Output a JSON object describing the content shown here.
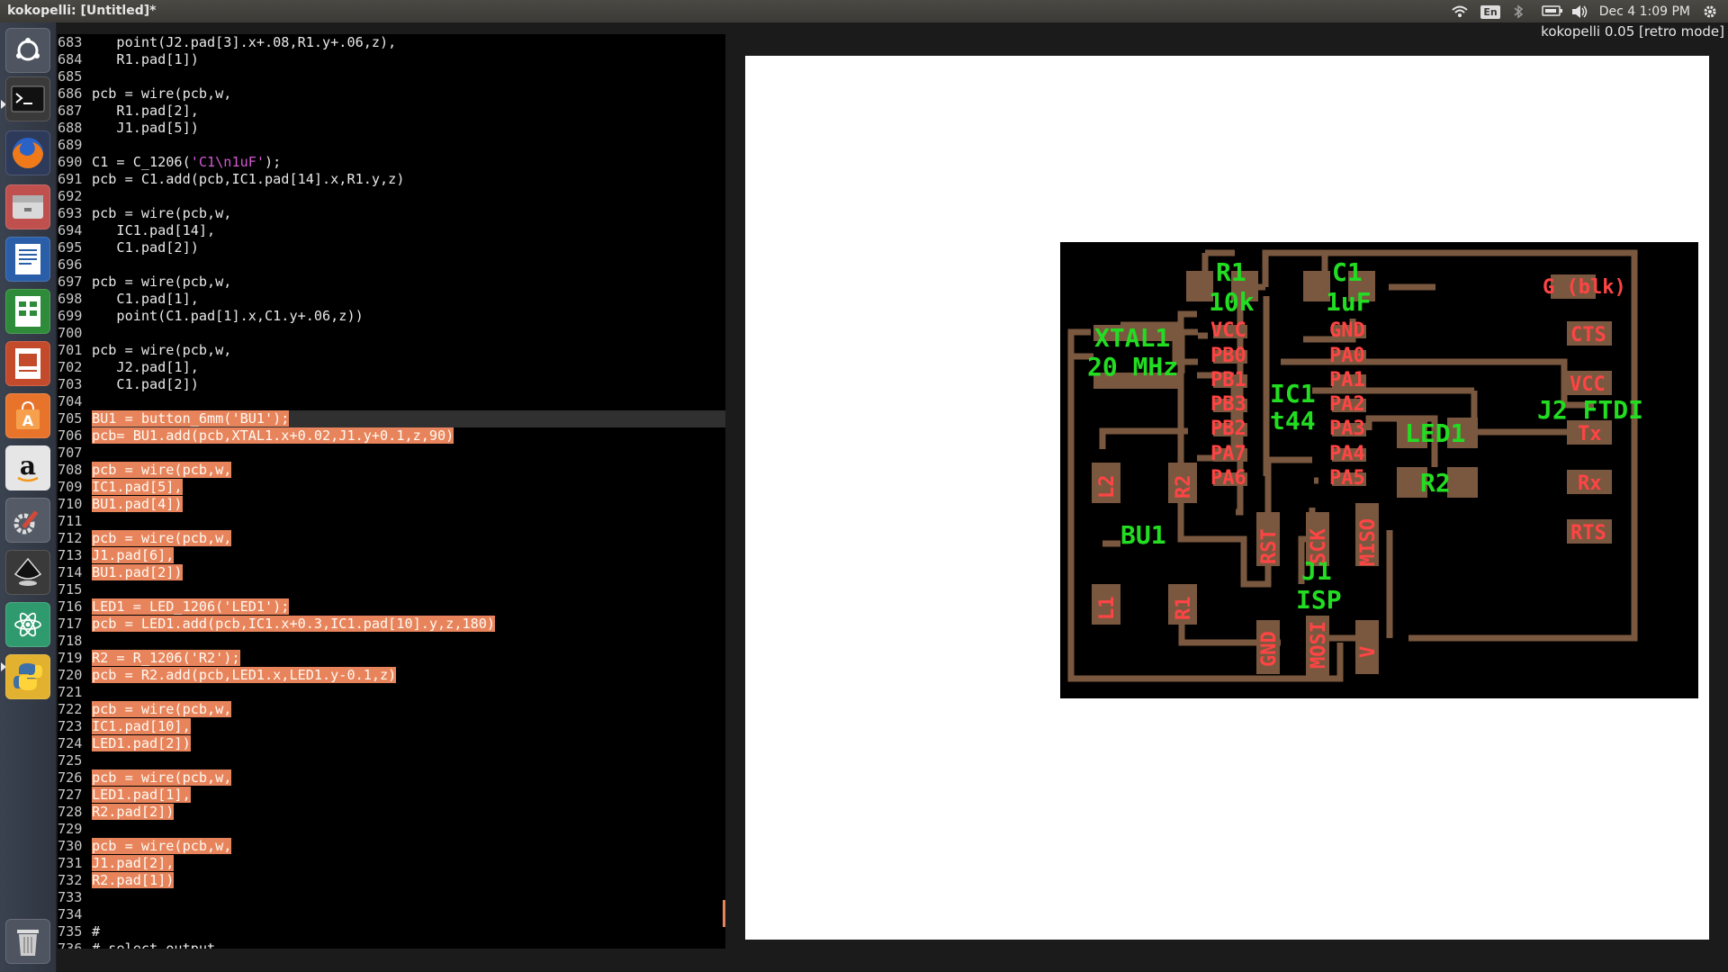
{
  "topbar": {
    "app_name": "kokopelli:",
    "doc_title": "[Untitled]*",
    "keyboard": "En",
    "datetime": "Dec 4  1:09 PM"
  },
  "version_label": "kokopelli 0.05 [retro mode]",
  "launcher": [
    "ubuntu-dash",
    "terminal",
    "firefox",
    "file-manager",
    "writer",
    "calc",
    "impress",
    "software-center",
    "amazon",
    "system-settings",
    "inkscape",
    "atom",
    "python",
    "trash"
  ],
  "editor": {
    "lines": [
      {
        "no": "683",
        "text": "   point(J2.pad[3].x+.08,R1.y+.06,z),",
        "sel": false
      },
      {
        "no": "684",
        "text": "   R1.pad[1])",
        "sel": false
      },
      {
        "no": "685",
        "text": "",
        "sel": false
      },
      {
        "no": "686",
        "text": "pcb = wire(pcb,w,",
        "sel": false
      },
      {
        "no": "687",
        "text": "   R1.pad[2],",
        "sel": false
      },
      {
        "no": "688",
        "text": "   J1.pad[5])",
        "sel": false
      },
      {
        "no": "689",
        "text": "",
        "sel": false
      },
      {
        "no": "690",
        "text": "C1 = C_1206(",
        "str": "'C1\\n1uF'",
        "after": ");",
        "sel": false
      },
      {
        "no": "691",
        "text": "pcb = C1.add(pcb,IC1.pad[14].x,R1.y,z)",
        "sel": false
      },
      {
        "no": "692",
        "text": "",
        "sel": false
      },
      {
        "no": "693",
        "text": "pcb = wire(pcb,w,",
        "sel": false
      },
      {
        "no": "694",
        "text": "   IC1.pad[14],",
        "sel": false
      },
      {
        "no": "695",
        "text": "   C1.pad[2])",
        "sel": false
      },
      {
        "no": "696",
        "text": "",
        "sel": false
      },
      {
        "no": "697",
        "text": "pcb = wire(pcb,w,",
        "sel": false
      },
      {
        "no": "698",
        "text": "   C1.pad[1],",
        "sel": false
      },
      {
        "no": "699",
        "text": "   point(C1.pad[1].x,C1.y+.06,z))",
        "sel": false
      },
      {
        "no": "700",
        "text": "",
        "sel": false
      },
      {
        "no": "701",
        "text": "pcb = wire(pcb,w,",
        "sel": false
      },
      {
        "no": "702",
        "text": "   J2.pad[1],",
        "sel": false
      },
      {
        "no": "703",
        "text": "   C1.pad[2])",
        "sel": false
      },
      {
        "no": "704",
        "text": "",
        "sel": false
      },
      {
        "no": "705",
        "text": "BU1 = button_6mm('BU1');",
        "sel": true,
        "current": true
      },
      {
        "no": "706",
        "text": "pcb= BU1.add(pcb,XTAL1.x+0.02,J1.y+0.1,z,90)",
        "sel": true
      },
      {
        "no": "707",
        "text": "",
        "sel": true
      },
      {
        "no": "708",
        "text": "pcb = wire(pcb,w,",
        "sel": true
      },
      {
        "no": "709",
        "text": "IC1.pad[5],",
        "sel": true
      },
      {
        "no": "710",
        "text": "BU1.pad[4])",
        "sel": true
      },
      {
        "no": "711",
        "text": "",
        "sel": true
      },
      {
        "no": "712",
        "text": "pcb = wire(pcb,w,",
        "sel": true
      },
      {
        "no": "713",
        "text": "J1.pad[6],",
        "sel": true
      },
      {
        "no": "714",
        "text": "BU1.pad[2])",
        "sel": true
      },
      {
        "no": "715",
        "text": "",
        "sel": true
      },
      {
        "no": "716",
        "text": "LED1 = LED_1206('LED1');",
        "sel": true
      },
      {
        "no": "717",
        "text": "pcb = LED1.add(pcb,IC1.x+0.3,IC1.pad[10].y,z,180)",
        "sel": true
      },
      {
        "no": "718",
        "text": "",
        "sel": true
      },
      {
        "no": "719",
        "text": "R2 = R_1206('R2');",
        "sel": true
      },
      {
        "no": "720",
        "text": "pcb = R2.add(pcb,LED1.x,LED1.y-0.1,z)",
        "sel": true
      },
      {
        "no": "721",
        "text": "",
        "sel": true
      },
      {
        "no": "722",
        "text": "pcb = wire(pcb,w,",
        "sel": true
      },
      {
        "no": "723",
        "text": "IC1.pad[10],",
        "sel": true
      },
      {
        "no": "724",
        "text": "LED1.pad[2])",
        "sel": true
      },
      {
        "no": "725",
        "text": "",
        "sel": true
      },
      {
        "no": "726",
        "text": "pcb = wire(pcb,w,",
        "sel": true
      },
      {
        "no": "727",
        "text": "LED1.pad[1],",
        "sel": true
      },
      {
        "no": "728",
        "text": "R2.pad[2])",
        "sel": true
      },
      {
        "no": "729",
        "text": "",
        "sel": true
      },
      {
        "no": "730",
        "text": "pcb = wire(pcb,w,",
        "sel": true
      },
      {
        "no": "731",
        "text": "J1.pad[2],",
        "sel": true
      },
      {
        "no": "732",
        "text": "R2.pad[1])",
        "sel": true
      },
      {
        "no": "733",
        "text": "",
        "sel": false
      },
      {
        "no": "734",
        "text": "",
        "sel": false
      },
      {
        "no": "735",
        "text": "#",
        "sel": false
      },
      {
        "no": "736",
        "text": "# select output",
        "sel": false
      }
    ]
  },
  "board": {
    "labels": {
      "r1": "R1",
      "r1_val": "10k",
      "c1": "C1",
      "c1_val": "1uF",
      "xtal": "XTAL1",
      "xtal_val": "20 MHz",
      "ic1": "IC1",
      "ic1_val": "t44",
      "led1": "LED1",
      "r2": "R2",
      "bu1": "BU1",
      "j1": "J1",
      "j1_val": "ISP",
      "j2": "J2 FTDI"
    },
    "pins": {
      "vcc": "VCC",
      "pb0": "PB0",
      "pb1": "PB1",
      "pb3": "PB3",
      "pb2": "PB2",
      "pa7": "PA7",
      "pa6": "PA6",
      "gnd": "GND",
      "pa0": "PA0",
      "pa1": "PA1",
      "pa2": "PA2",
      "pa3": "PA3",
      "pa4": "PA4",
      "pa5": "PA5",
      "ftdi_g": "G (blk)",
      "cts": "CTS",
      "ftdi_vcc": "VCC",
      "tx": "Tx",
      "rx": "Rx",
      "rts": "RTS",
      "l2": "L2",
      "r2v": "R2",
      "l1": "L1",
      "r1v": "R1",
      "rst": "RST",
      "sck": "SCK",
      "miso": "MISO",
      "isp_gnd": "GND",
      "mosi": "MOSI",
      "v": "V"
    },
    "colors": {
      "trace": "#7a5840",
      "green": "#22dd22",
      "red": "#ff4444",
      "background": "#000000"
    }
  }
}
